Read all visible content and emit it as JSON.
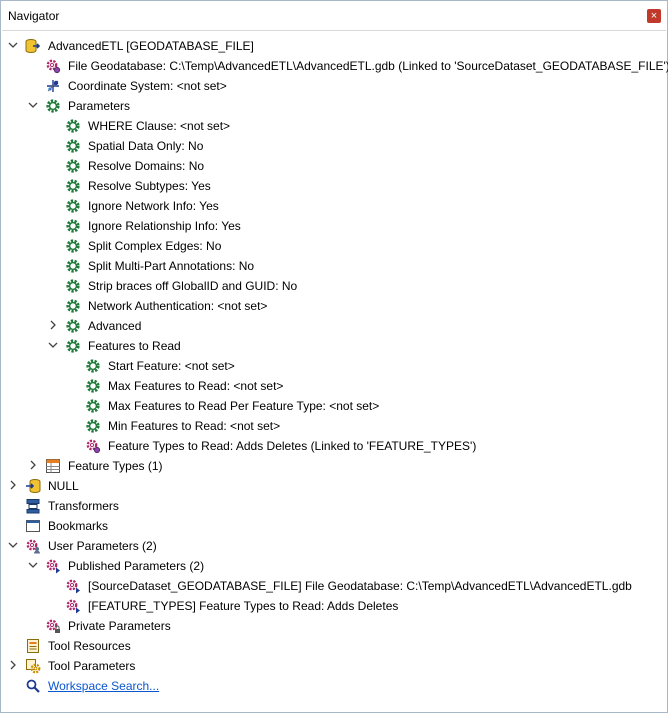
{
  "window": {
    "title": "Navigator",
    "close_label": "×"
  },
  "tree": [
    {
      "label": "AdvancedETL [GEODATABASE_FILE]",
      "icon": "dataset-reader-icon",
      "expander": "open"
    },
    {
      "label": "File Geodatabase: C:\\Temp\\AdvancedETL\\AdvancedETL.gdb (Linked to 'SourceDataset_GEODATABASE_FILE')",
      "icon": "linked-parameter-icon",
      "expander": "none"
    },
    {
      "label": "Coordinate System: <not set>",
      "icon": "coordinate-system-icon",
      "expander": "none"
    },
    {
      "label": "Parameters",
      "icon": "gear-icon",
      "expander": "open"
    },
    {
      "label": "WHERE Clause: <not set>",
      "icon": "gear-icon",
      "expander": "none"
    },
    {
      "label": "Spatial Data Only: No",
      "icon": "gear-icon",
      "expander": "none"
    },
    {
      "label": "Resolve Domains: No",
      "icon": "gear-icon",
      "expander": "none"
    },
    {
      "label": "Resolve Subtypes: Yes",
      "icon": "gear-icon",
      "expander": "none"
    },
    {
      "label": "Ignore Network Info: Yes",
      "icon": "gear-icon",
      "expander": "none"
    },
    {
      "label": "Ignore Relationship Info: Yes",
      "icon": "gear-icon",
      "expander": "none"
    },
    {
      "label": "Split Complex Edges: No",
      "icon": "gear-icon",
      "expander": "none"
    },
    {
      "label": "Split Multi-Part Annotations: No",
      "icon": "gear-icon",
      "expander": "none"
    },
    {
      "label": "Strip braces off GlobalID and GUID: No",
      "icon": "gear-icon",
      "expander": "none"
    },
    {
      "label": "Network Authentication: <not set>",
      "icon": "gear-icon",
      "expander": "none"
    },
    {
      "label": "Advanced",
      "icon": "gear-icon",
      "expander": "closed"
    },
    {
      "label": "Features to Read",
      "icon": "gear-icon",
      "expander": "open"
    },
    {
      "label": "Start Feature: <not set>",
      "icon": "gear-icon",
      "expander": "none"
    },
    {
      "label": "Max Features to Read: <not set>",
      "icon": "gear-icon",
      "expander": "none"
    },
    {
      "label": "Max Features to Read Per Feature Type: <not set>",
      "icon": "gear-icon",
      "expander": "none"
    },
    {
      "label": "Min Features to Read: <not set>",
      "icon": "gear-icon",
      "expander": "none"
    },
    {
      "label": "Feature Types to Read: Adds Deletes (Linked to 'FEATURE_TYPES')",
      "icon": "linked-parameter-icon",
      "expander": "none"
    },
    {
      "label": "Feature Types (1)",
      "icon": "feature-types-icon",
      "expander": "closed"
    },
    {
      "label": "NULL",
      "icon": "null-writer-icon",
      "expander": "closed"
    },
    {
      "label": "Transformers",
      "icon": "transformers-icon",
      "expander": "none"
    },
    {
      "label": "Bookmarks",
      "icon": "bookmarks-icon",
      "expander": "none"
    },
    {
      "label": "User Parameters (2)",
      "icon": "user-parameters-icon",
      "expander": "open"
    },
    {
      "label": "Published Parameters (2)",
      "icon": "published-parameters-icon",
      "expander": "open"
    },
    {
      "label": "[SourceDataset_GEODATABASE_FILE] File Geodatabase: C:\\Temp\\AdvancedETL\\AdvancedETL.gdb",
      "icon": "published-parameter-icon",
      "expander": "none"
    },
    {
      "label": "[FEATURE_TYPES] Feature Types to Read: Adds Deletes",
      "icon": "published-parameter-icon",
      "expander": "none"
    },
    {
      "label": "Private Parameters",
      "icon": "private-parameters-icon",
      "expander": "none"
    },
    {
      "label": "Tool Resources",
      "icon": "tool-resources-icon",
      "expander": "none"
    },
    {
      "label": "Tool Parameters",
      "icon": "tool-parameters-icon",
      "expander": "closed"
    },
    {
      "label": "Workspace Search...",
      "icon": "search-icon",
      "expander": "none",
      "link": true
    }
  ]
}
